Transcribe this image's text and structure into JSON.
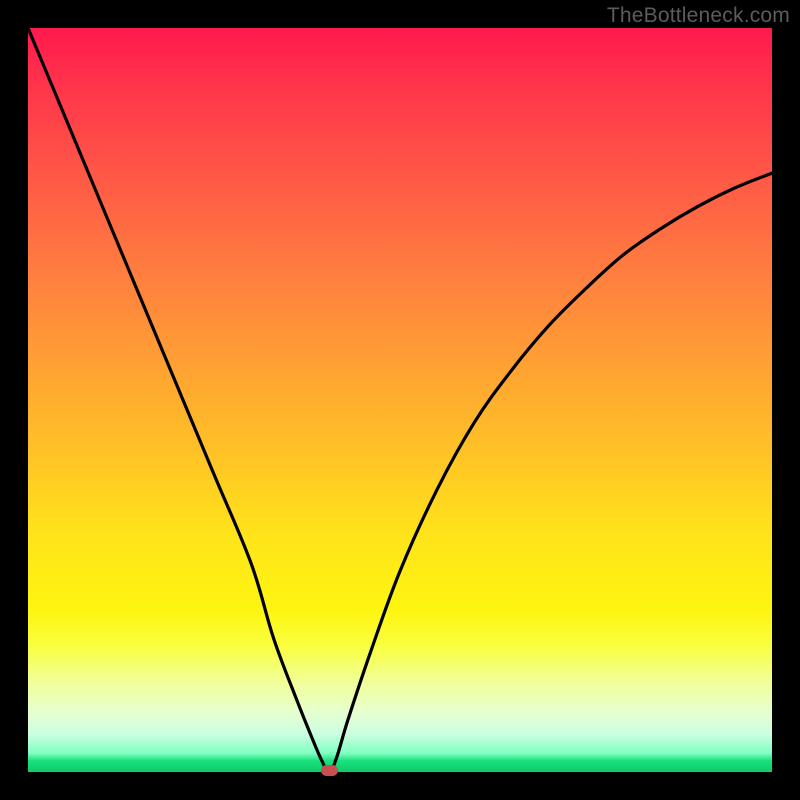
{
  "watermark": "TheBottleneck.com",
  "colors": {
    "frame": "#000000",
    "curve": "#000000",
    "marker": "#c84f4f",
    "gradient_top": "#ff1a4d",
    "gradient_bottom": "#0fca6c"
  },
  "chart_data": {
    "type": "line",
    "title": "",
    "xlabel": "",
    "ylabel": "",
    "xlim": [
      0,
      100
    ],
    "ylim": [
      0,
      100
    ],
    "x": [
      0,
      5,
      10,
      15,
      20,
      25,
      30,
      33,
      36,
      38,
      39.5,
      40.5,
      41.5,
      43,
      46,
      50,
      55,
      60,
      65,
      70,
      75,
      80,
      85,
      90,
      95,
      100
    ],
    "values": [
      100,
      88,
      76,
      64,
      52,
      40,
      28,
      18,
      10,
      5,
      1.5,
      0,
      2,
      7,
      16,
      27,
      38,
      47,
      54,
      60,
      65,
      69.5,
      73,
      76,
      78.5,
      80.5
    ],
    "minimum_marker": {
      "x": 40.5,
      "y": 0
    },
    "notes": "Values are bottleneck percentage (y) versus configuration position (x). Values are estimated — axes unlabeled in source image."
  }
}
